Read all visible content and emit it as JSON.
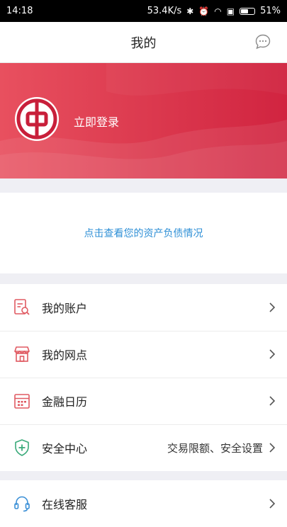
{
  "status_bar": {
    "time": "14:18",
    "network_speed": "53.4K/s",
    "battery": "51%",
    "icons": [
      "bluetooth-icon",
      "alarm-icon",
      "wifi-icon",
      "sim-icon",
      "battery-icon"
    ]
  },
  "header": {
    "title": "我的",
    "message_icon": "chat-bubble-icon"
  },
  "banner": {
    "login_label": "立即登录",
    "logo_icon": "bank-of-china-logo",
    "colors": {
      "start": "#e8505f",
      "end": "#d12440"
    }
  },
  "assets": {
    "link_label": "点击查看您的资产负债情况",
    "link_color": "#2e8fd6"
  },
  "menu": {
    "items": [
      {
        "label": "我的账户",
        "icon": "account-document-icon",
        "extra": ""
      },
      {
        "label": "我的网点",
        "icon": "branch-store-icon",
        "extra": ""
      },
      {
        "label": "金融日历",
        "icon": "calendar-icon",
        "extra": ""
      },
      {
        "label": "安全中心",
        "icon": "shield-plus-icon",
        "extra": "交易限额、安全设置"
      }
    ],
    "items2": [
      {
        "label": "在线客服",
        "icon": "headset-icon",
        "extra": ""
      }
    ],
    "icon_color_red": "#e05a62",
    "icon_color_green": "#3aaa7a",
    "icon_color_blue": "#3a8fd6"
  }
}
